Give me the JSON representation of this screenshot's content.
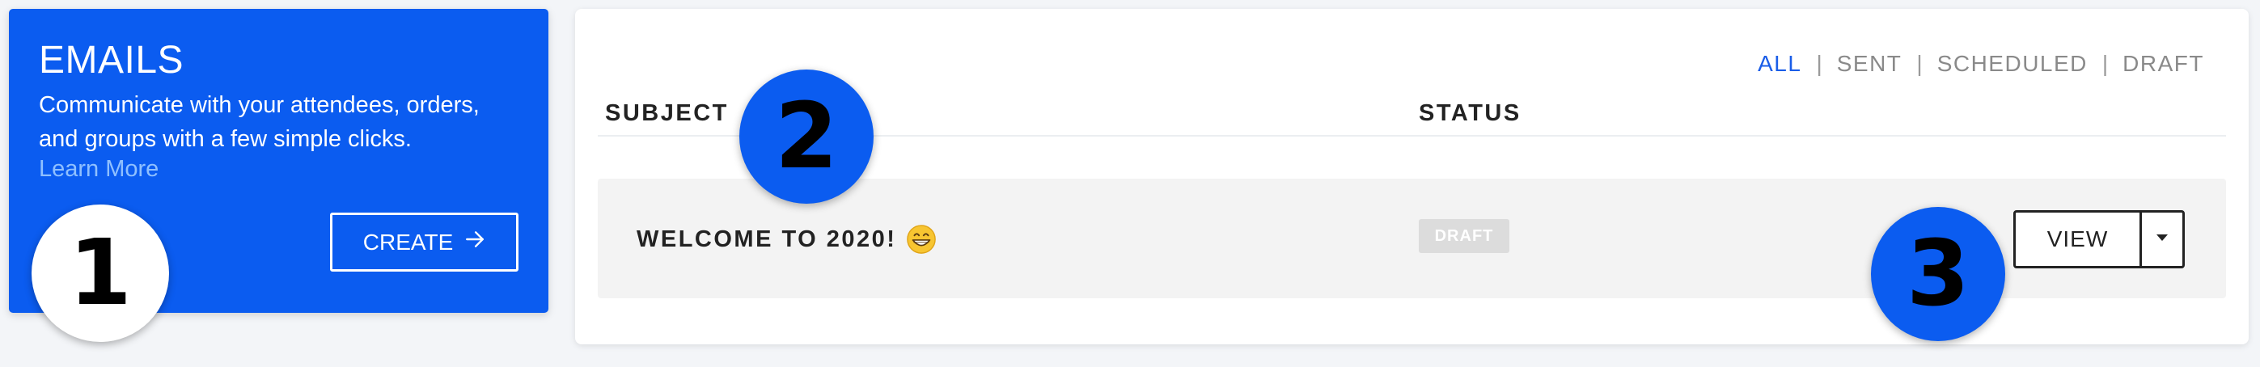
{
  "promo": {
    "title": "EMAILS",
    "description": "Communicate with your attendees, orders, and groups with a few simple clicks.",
    "learn_more": "Learn More",
    "create_label": "CREATE"
  },
  "filters": {
    "items": [
      "ALL",
      "SENT",
      "SCHEDULED",
      "DRAFT"
    ],
    "active": "ALL",
    "separator": "|"
  },
  "table": {
    "columns": [
      "SUBJECT",
      "STATUS"
    ],
    "rows": [
      {
        "subject": "WELCOME TO 2020!",
        "emoji": "grinning-face-icon",
        "status": "DRAFT",
        "action_label": "VIEW"
      }
    ]
  },
  "markers": [
    "1",
    "2",
    "3"
  ],
  "colors": {
    "accent": "#0b5cf0",
    "active_filter": "#1a5de8",
    "badge": "#dcdcdc"
  }
}
